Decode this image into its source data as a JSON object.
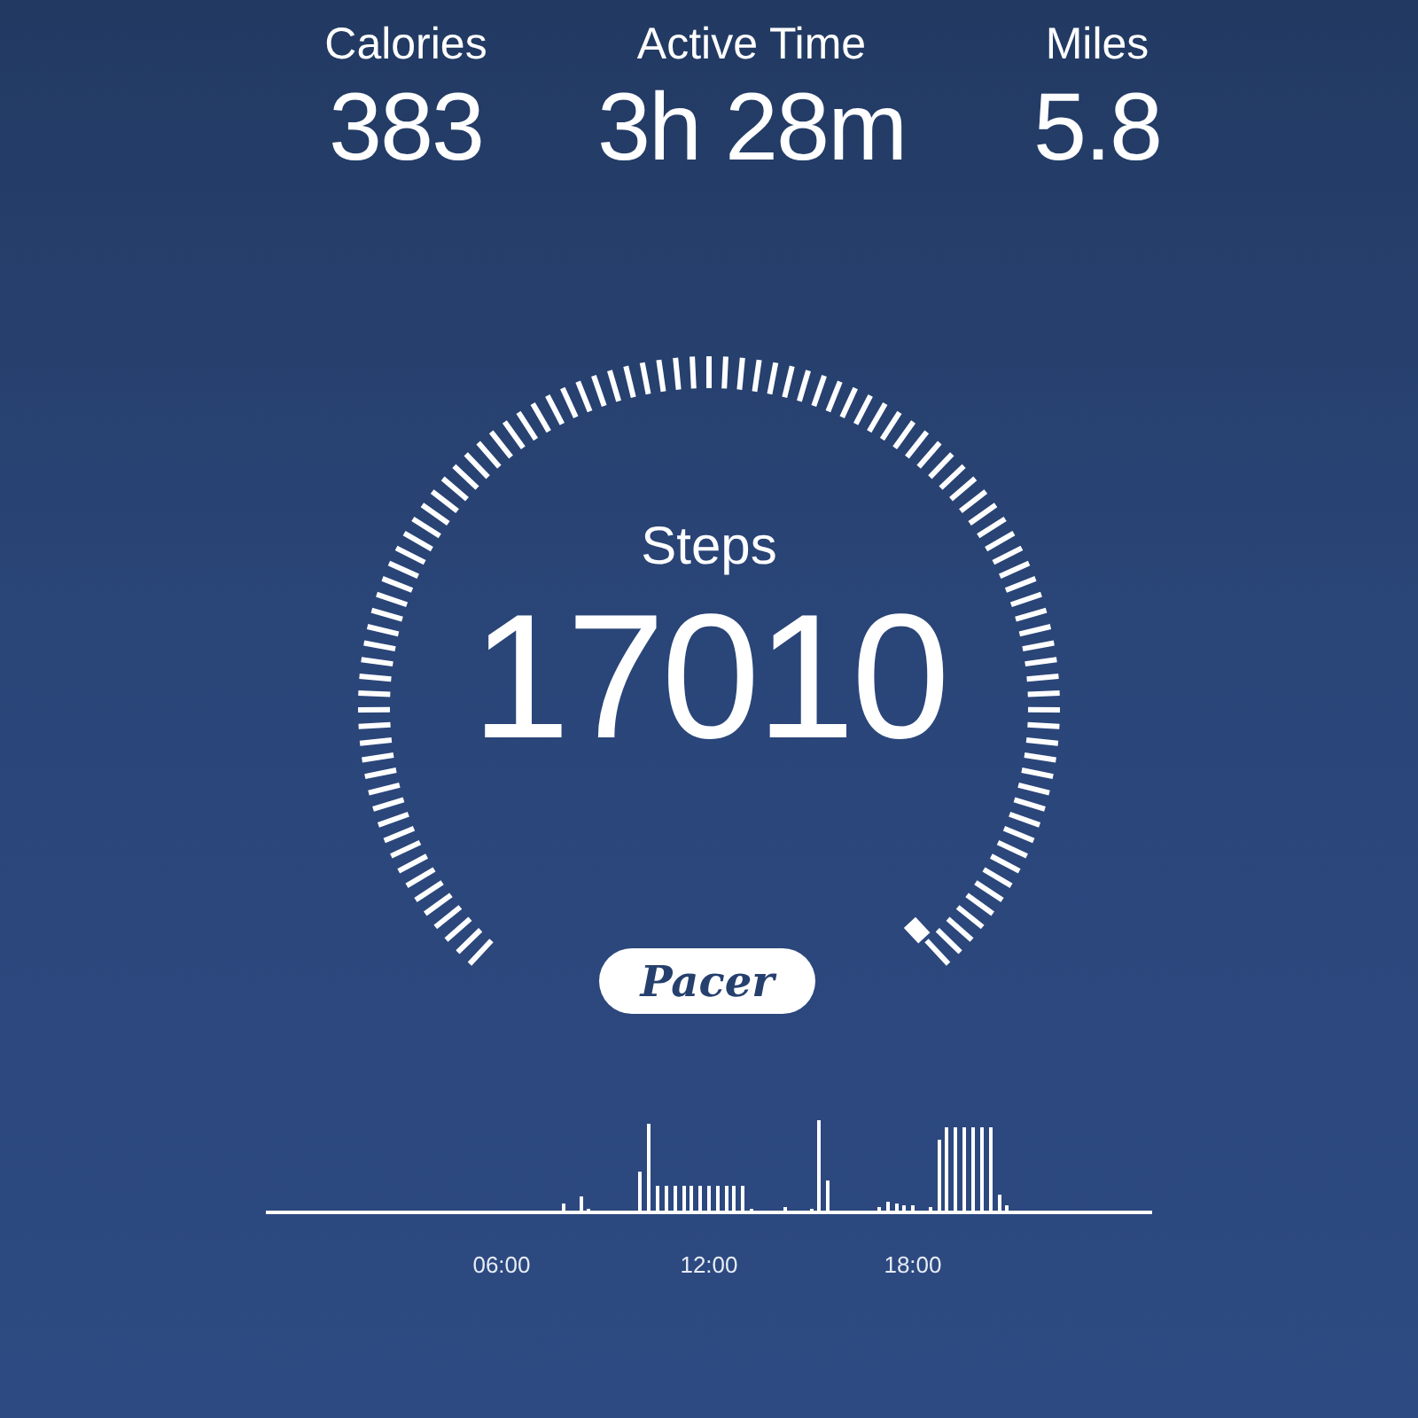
{
  "stats": [
    {
      "label": "Calories",
      "value": "383"
    },
    {
      "label": "Active Time",
      "value": "3h 28m"
    },
    {
      "label": "Miles",
      "value": "5.8"
    }
  ],
  "gauge": {
    "label": "Steps",
    "value": "17010"
  },
  "logo": {
    "text": "Pacer"
  },
  "activity_chart": {
    "time_labels": [
      "06:00",
      "12:00",
      "18:00"
    ]
  }
}
